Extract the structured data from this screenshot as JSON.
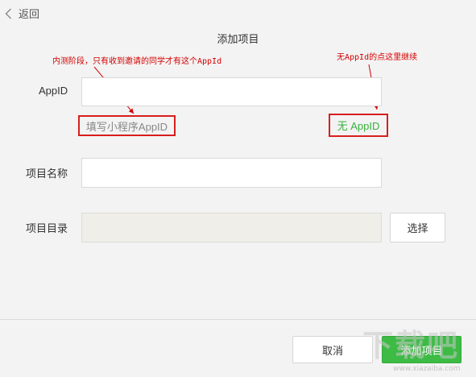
{
  "header": {
    "back_label": "返回",
    "title": "添加项目"
  },
  "annotations": {
    "left": "内测阶段，只有收到邀请的同学才有这个AppId",
    "right": "无AppId的点这里继续",
    "color": "#d40000"
  },
  "form": {
    "appid": {
      "label": "AppID",
      "value": "",
      "hint": "填写小程序AppID",
      "no_appid_link": "无 AppID"
    },
    "name": {
      "label": "项目名称",
      "value": ""
    },
    "dir": {
      "label": "项目目录",
      "value": "",
      "choose_button": "选择"
    }
  },
  "footer": {
    "cancel_label": "取消",
    "submit_label": "添加项目"
  },
  "watermark": {
    "logo_text": "下载吧",
    "url": "www.xiazaiba.com"
  },
  "colors": {
    "accent_green": "#3dbb45",
    "annotation_red": "#d81e1e",
    "link_green": "#38b03f"
  }
}
